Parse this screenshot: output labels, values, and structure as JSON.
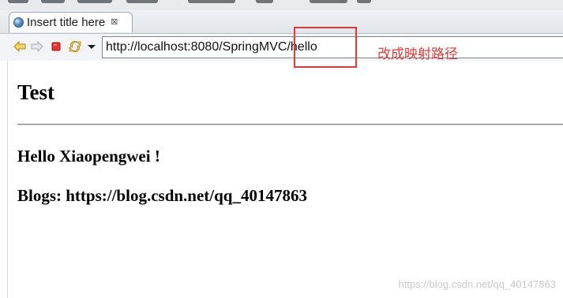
{
  "tab": {
    "title": "Insert title here",
    "close_glyph": "⊠",
    "icon": "globe-icon"
  },
  "toolbar": {
    "back_icon": "back-arrow-icon",
    "forward_icon": "forward-arrow-icon",
    "stop_icon": "stop-icon",
    "refresh_icon": "refresh-icon",
    "menu_icon": "dropdown-triangle-icon"
  },
  "address": {
    "url": "http://localhost:8080/SpringMVC/hello"
  },
  "annotation": {
    "text": "改成映射路径",
    "color": "#e53935"
  },
  "page": {
    "heading": "Test",
    "greeting": "Hello Xiaopengwei !",
    "blogs": "Blogs: https://blog.csdn.net/qq_40147863"
  },
  "watermark": {
    "text": "https://blog.csdn.net/qq_40147863"
  }
}
